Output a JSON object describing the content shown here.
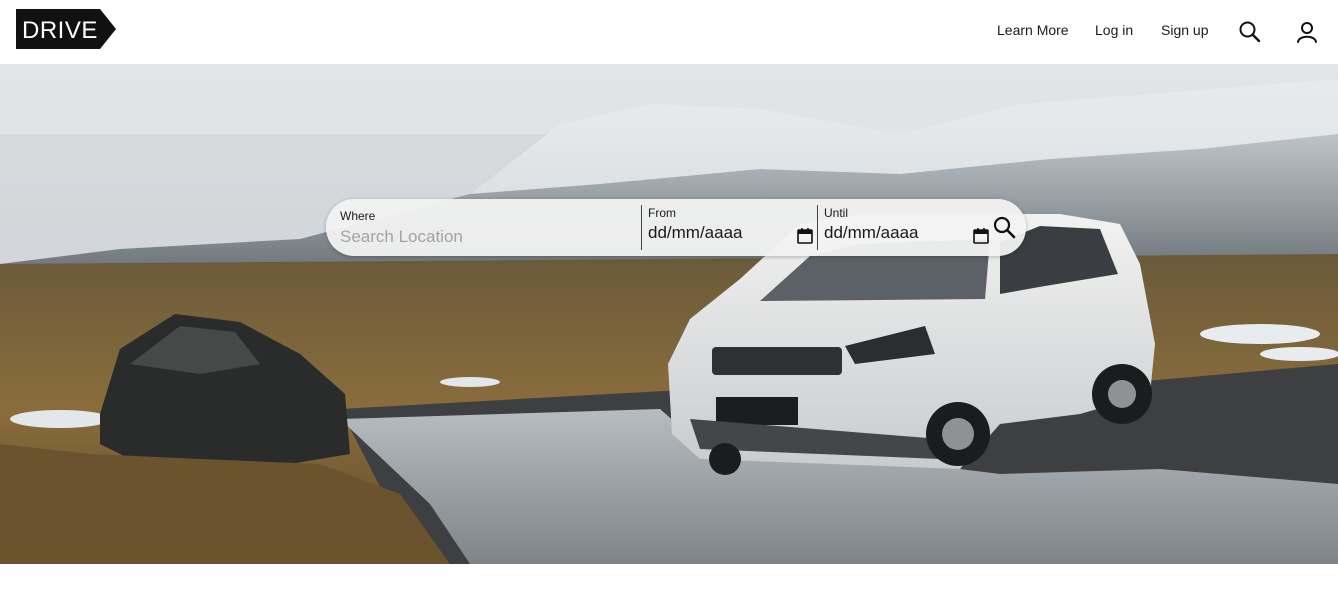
{
  "brand": {
    "logo_text": "DRIVE"
  },
  "nav": {
    "learn_more": "Learn More",
    "log_in": "Log in",
    "sign_up": "Sign up",
    "search_icon": "search-icon",
    "user_icon": "user-icon"
  },
  "search": {
    "where_label": "Where",
    "where_placeholder": "Search Location",
    "from_label": "From",
    "from_value": "dd/mm/aaaa",
    "until_label": "Until",
    "until_value": "dd/mm/aaaa",
    "calendar_icon": "calendar-icon",
    "submit_icon": "search-icon"
  },
  "hero": {
    "image": "white SUV parked on wet ground in snowy mountain landscape"
  }
}
